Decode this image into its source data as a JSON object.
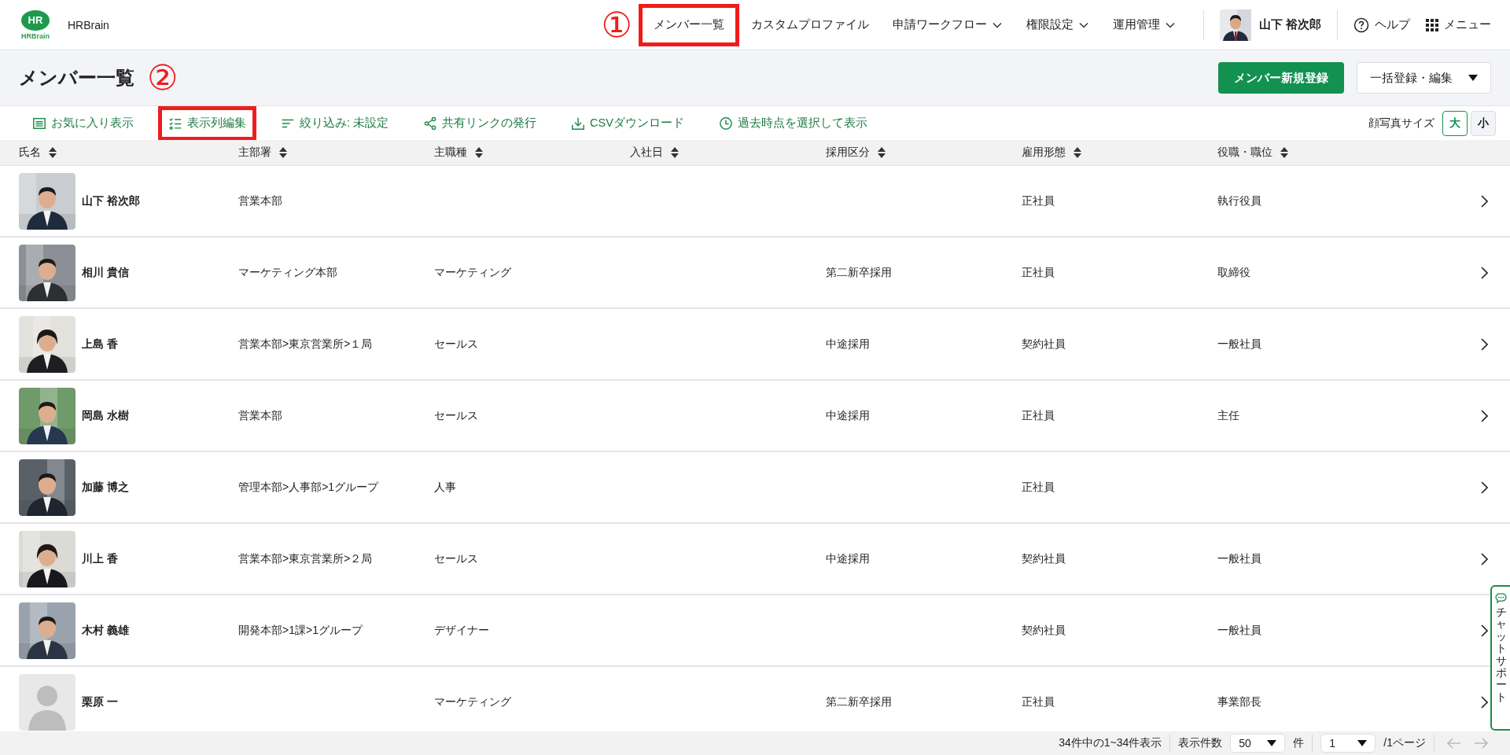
{
  "header": {
    "logo": {
      "badge": "HR",
      "wordmark": "HRBrain"
    },
    "app_name": "HRBrain",
    "nav_annotation": "①",
    "nav": [
      {
        "label": "メンバー一覧",
        "dropdown": false,
        "highlighted": true
      },
      {
        "label": "カスタムプロファイル",
        "dropdown": false,
        "highlighted": false
      },
      {
        "label": "申請ワークフロー",
        "dropdown": true,
        "highlighted": false
      },
      {
        "label": "権限設定",
        "dropdown": true,
        "highlighted": false
      },
      {
        "label": "運用管理",
        "dropdown": true,
        "highlighted": false
      }
    ],
    "user": {
      "name": "山下 裕次郎"
    },
    "help": "ヘルプ",
    "menu": "メニュー"
  },
  "page": {
    "title": "メンバー一覧",
    "title_annotation": "②",
    "primary_button": "メンバー新規登録",
    "secondary_button": "一括登録・編集"
  },
  "toolbar": [
    {
      "kind": "list",
      "label": "お気に入り表示",
      "highlighted": false
    },
    {
      "kind": "checklist",
      "label": "表示列編集",
      "highlighted": true
    },
    {
      "kind": "filter",
      "label": "絞り込み: 未設定",
      "highlighted": false
    },
    {
      "kind": "share",
      "label": "共有リンクの発行",
      "highlighted": false
    },
    {
      "kind": "download",
      "label": "CSVダウンロード",
      "highlighted": false
    },
    {
      "kind": "clock",
      "label": "過去時点を選択して表示",
      "highlighted": false
    }
  ],
  "photo_size": {
    "label": "顔写真サイズ",
    "options": [
      {
        "label": "大",
        "selected": true
      },
      {
        "label": "小",
        "selected": false
      }
    ]
  },
  "table": {
    "columns": [
      "氏名",
      "主部署",
      "主職種",
      "入社日",
      "採用区分",
      "雇用形態",
      "役職・職位"
    ],
    "rows": [
      {
        "name": "山下 裕次郎",
        "department": "営業本部",
        "employment": "正社員",
        "position": "執行役員"
      },
      {
        "name": "相川 貴信",
        "department": "マーケティング本部",
        "job": "マーケティング",
        "hiring": "第二新卒採用",
        "employment": "正社員",
        "position": "取締役"
      },
      {
        "name": "上島 香",
        "department": "営業本部>東京営業所>１局",
        "job": "セールス",
        "hiring": "中途採用",
        "employment": "契約社員",
        "position": "一般社員"
      },
      {
        "name": "岡島 水樹",
        "department": "営業本部",
        "job": "セールス",
        "hiring": "中途採用",
        "employment": "正社員",
        "position": "主任"
      },
      {
        "name": "加藤 博之",
        "department": "管理本部>人事部>1グループ",
        "job": "人事",
        "employment": "正社員"
      },
      {
        "name": "川上 香",
        "department": "営業本部>東京営業所>２局",
        "job": "セールス",
        "hiring": "中途採用",
        "employment": "契約社員",
        "position": "一般社員"
      },
      {
        "name": "木村 義雄",
        "department": "開発本部>1課>1グループ",
        "job": "デザイナー",
        "employment": "契約社員",
        "position": "一般社員"
      },
      {
        "photo": {
          "kind": "placeholder"
        },
        "name": "栗原 一",
        "job": "マーケティング",
        "hiring": "第二新卒採用",
        "employment": "正社員",
        "position": "事業部長"
      }
    ]
  },
  "footer": {
    "summary": "34件中の1~34件表示",
    "per_page_label": "表示件数",
    "per_page": "50",
    "per_page_unit": "件",
    "page": "1",
    "page_total": "/1ページ",
    "prev_disabled": true,
    "next_disabled": true
  },
  "chat_support": "チャットサポート"
}
